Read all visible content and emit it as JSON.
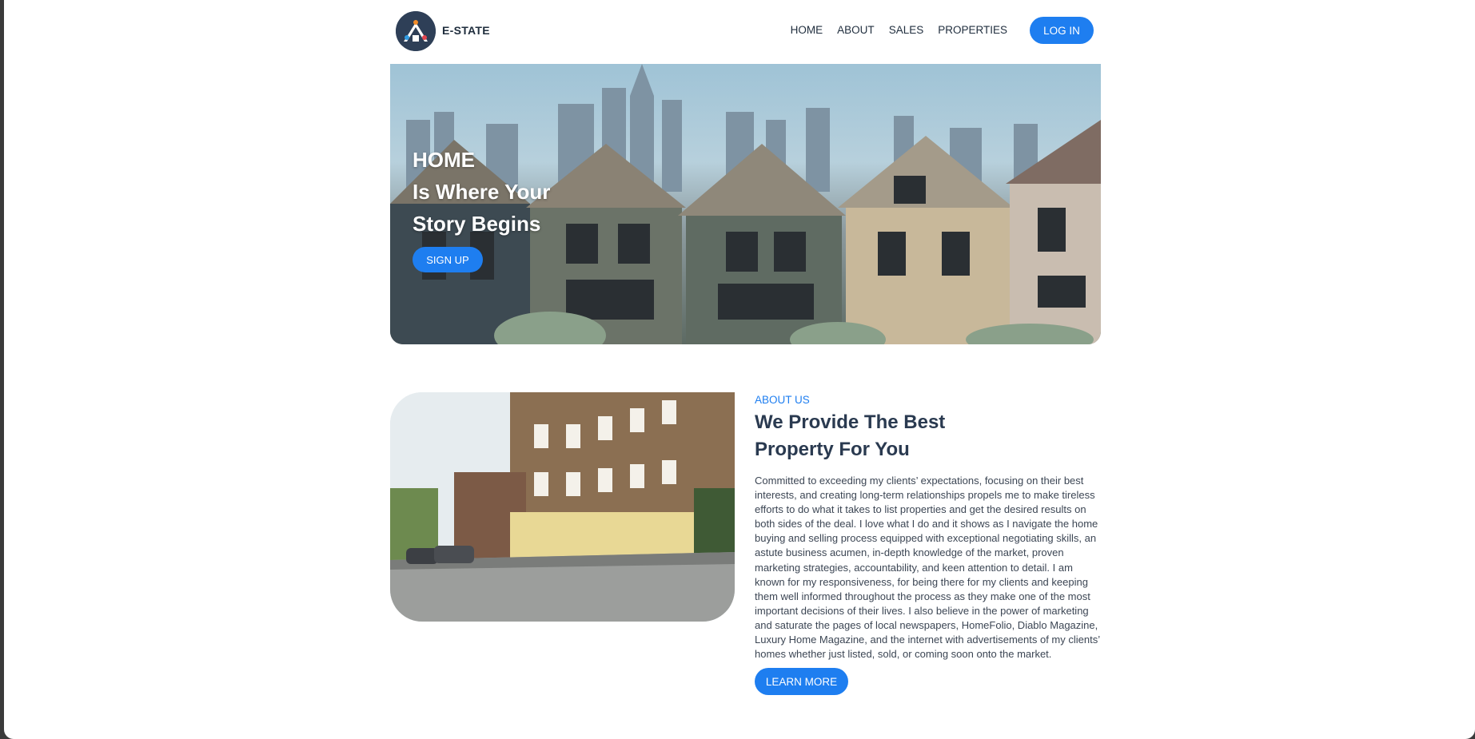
{
  "header": {
    "brand": "E-STATE",
    "nav": [
      "HOME",
      "ABOUT",
      "SALES",
      "PROPERTIES"
    ],
    "login_label": "LOG IN"
  },
  "hero": {
    "title_line1": "HOME",
    "title_line2": "Is Where Your",
    "title_line3": "Story Begins",
    "signup_label": "SIGN UP"
  },
  "about": {
    "eyebrow": "ABOUT US",
    "title_line1": "We Provide The Best",
    "title_line2": "Property For You",
    "body": "Committed to exceeding my clients’ expectations, focusing on their best interests, and creating long-term relationships propels me to make tireless efforts to do what it takes to list properties and get the desired results on both sides of the deal. I love what I do and it shows as I navigate the home buying and selling process equipped with exceptional negotiating skills, an astute business acumen, in-depth knowledge of the market, proven marketing strategies, accountability, and keen attention to detail. I am known for my responsiveness, for being there for my clients and keeping them well informed throughout the process as they make one of the most important decisions of their lives. I also believe in the power of marketing and saturate the pages of local newspapers, HomeFolio, Diablo Magazine, Luxury Home Magazine, and the internet with advertisements of my clients’ homes whether just listed, sold, or coming soon onto the market.",
    "button_label": "LEARN MORE"
  },
  "colors": {
    "accent": "#1e7ef0",
    "heading": "#2a3a50",
    "logo_bg": "#2e3f57"
  }
}
